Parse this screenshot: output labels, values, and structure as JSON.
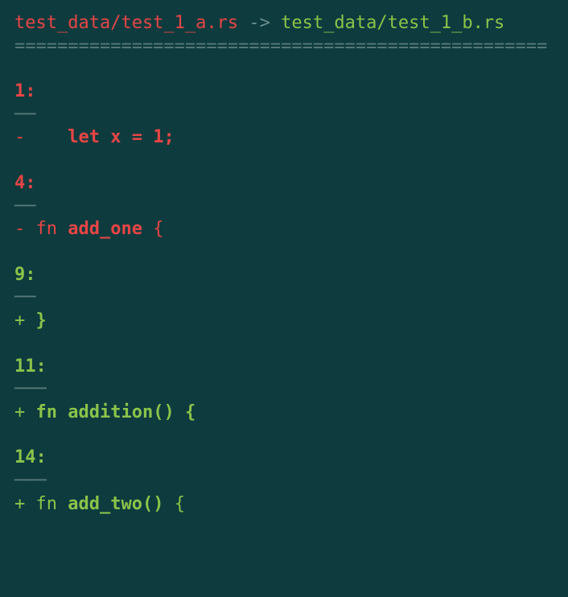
{
  "header": {
    "file_from": "test_data/test_1_a.rs",
    "arrow": "->",
    "file_to": "test_data/test_1_b.rs",
    "divider": "=================================================="
  },
  "hunks": [
    {
      "lineno": "1:",
      "underline": "──",
      "sign": "-",
      "content_prefix": "    ",
      "content_keyword": "let",
      "content_rest": " x = 1;",
      "sign_color": "red",
      "content_color": "red"
    },
    {
      "lineno": "4:",
      "underline": "──",
      "sign": "-",
      "content_prefix": " fn ",
      "content_keyword": "add_one",
      "content_rest": " {",
      "sign_color": "red",
      "content_color": "red"
    },
    {
      "lineno": "9:",
      "underline": "──",
      "sign": "+",
      "content_prefix": " ",
      "content_keyword": "}",
      "content_rest": "",
      "sign_color": "green",
      "content_color": "green"
    },
    {
      "lineno": "11:",
      "underline": "───",
      "sign": "+",
      "content_prefix": " ",
      "content_keyword": "fn",
      "content_rest": " ",
      "content_bold2": "addition()",
      "content_rest2": " {",
      "sign_color": "green",
      "content_color": "green"
    },
    {
      "lineno": "14:",
      "underline": "───",
      "sign": "+",
      "content_prefix": " fn ",
      "content_keyword": "add_two()",
      "content_rest": " {",
      "sign_color": "green",
      "content_color": "green"
    }
  ]
}
